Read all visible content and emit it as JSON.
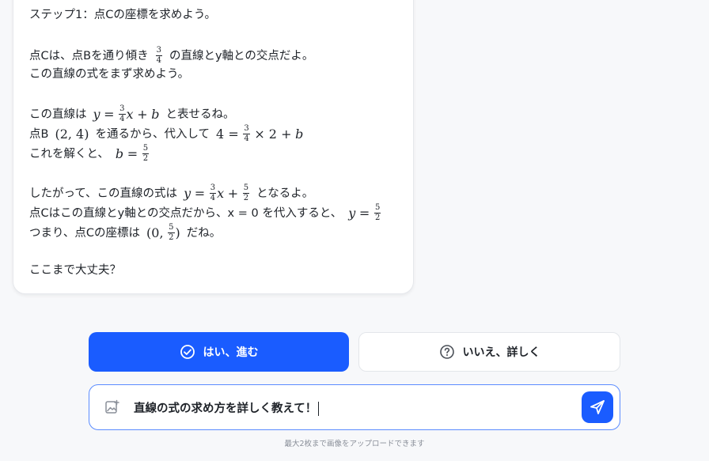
{
  "message": {
    "step_title": "ステップ1：点Cの座標を求めよう。",
    "p1_a": "点Cは、点Bを通り傾き",
    "p1_frac_num": "3",
    "p1_frac_den": "4",
    "p1_b": "の直線とy軸との交点だよ。",
    "p2": "この直線の式をまず求めよう。",
    "p3_a": "この直線は",
    "p3_m1": "y",
    "p3_eq": "=",
    "p3_frac_num": "3",
    "p3_frac_den": "4",
    "p3_m2": "x",
    "p3_plus": "+",
    "p3_m3": "b",
    "p3_b": "と表せるね。",
    "p4_a": "点B",
    "p4_paren": "(2, 4)",
    "p4_b": "を通るから、代入して",
    "p4_lhs": "4 =",
    "p4_frac_num": "3",
    "p4_frac_den": "4",
    "p4_rhs": "× 2 +",
    "p4_m": "b",
    "p5_a": "これを解くと、",
    "p5_m": "b",
    "p5_eq": "=",
    "p5_frac_num": "5",
    "p5_frac_den": "2",
    "p6_a": "したがって、この直線の式は",
    "p6_m1": "y",
    "p6_eq": "=",
    "p6_f1_num": "3",
    "p6_f1_den": "4",
    "p6_m2": "x",
    "p6_plus": "+",
    "p6_f2_num": "5",
    "p6_f2_den": "2",
    "p6_b": "となるよ。",
    "p7_a": "点Cはこの直線とy軸との交点だから、x = 0 を代入すると、",
    "p7_m": "y",
    "p7_eq": "=",
    "p7_frac_num": "5",
    "p7_frac_den": "2",
    "p8_a": "つまり、点Cの座標は",
    "p8_open": "(0,",
    "p8_frac_num": "5",
    "p8_frac_den": "2",
    "p8_close": ")",
    "p8_b": "だね。",
    "closing": "ここまで大丈夫？"
  },
  "actions": {
    "yes_label": "はい、進む",
    "no_label": "いいえ、詳しく"
  },
  "composer": {
    "value": "直線の式の求め方を詳しく教えて！",
    "upload_hint": "最大2枚まで画像をアップロードできます"
  },
  "colors": {
    "accent": "#1a5cff",
    "input_border": "#5b8cff"
  },
  "icons": {
    "yes": "check-circle-icon",
    "no": "question-circle-icon",
    "attach": "image-add-icon",
    "send": "send-icon"
  }
}
